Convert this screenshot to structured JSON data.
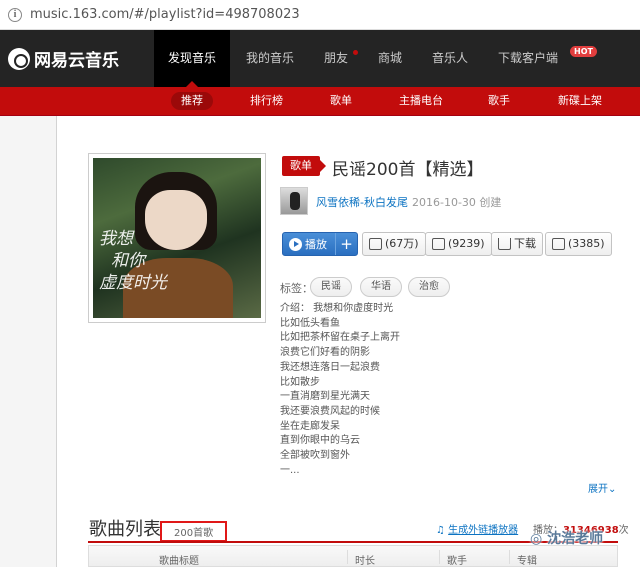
{
  "browser": {
    "url": "music.163.com/#/playlist?id=498708023"
  },
  "top_nav": {
    "logo": "网易云音乐",
    "items": [
      "发现音乐",
      "我的音乐",
      "朋友",
      "商城",
      "音乐人",
      "下载客户端"
    ],
    "hot_badge": "HOT"
  },
  "sub_nav": {
    "items": [
      "推荐",
      "排行榜",
      "歌单",
      "主播电台",
      "歌手",
      "新碟上架"
    ]
  },
  "playlist": {
    "badge": "歌单",
    "title": "民谣200首【精选】",
    "creator": "风雪依稀-秋白发尾",
    "created": "2016-10-30 创建",
    "buttons": {
      "play": "播放",
      "add": "+",
      "collect": "(67万)",
      "share": "(9239)",
      "download": "下载",
      "comment": "(3385)"
    },
    "tags_label": "标签：",
    "tags": [
      "民谣",
      "华语",
      "治愈"
    ],
    "description": [
      "介绍： 我想和你虚度时光",
      "比如低头看鱼",
      "比如把茶杯留在桌子上离开",
      "浪费它们好看的阴影",
      "我还想连落日一起浪费",
      "比如散步",
      "一直消磨到星光满天",
      "我还要浪费风起的时候",
      "坐在走廊发呆",
      "直到你眼中的乌云",
      "全部被吹到窗外",
      "一..."
    ],
    "expand": "展开",
    "cover_text": [
      "我想",
      "和你",
      "虚度时光"
    ]
  },
  "song_list": {
    "title": "歌曲列表",
    "count": "200首歌",
    "external_link": "生成外链播放器",
    "plays_label": "播放：",
    "plays_value": "31346938",
    "plays_suffix": "次",
    "headers": [
      "歌曲标题",
      "时长",
      "歌手",
      "专辑"
    ]
  },
  "watermark": "沈浩老师"
}
